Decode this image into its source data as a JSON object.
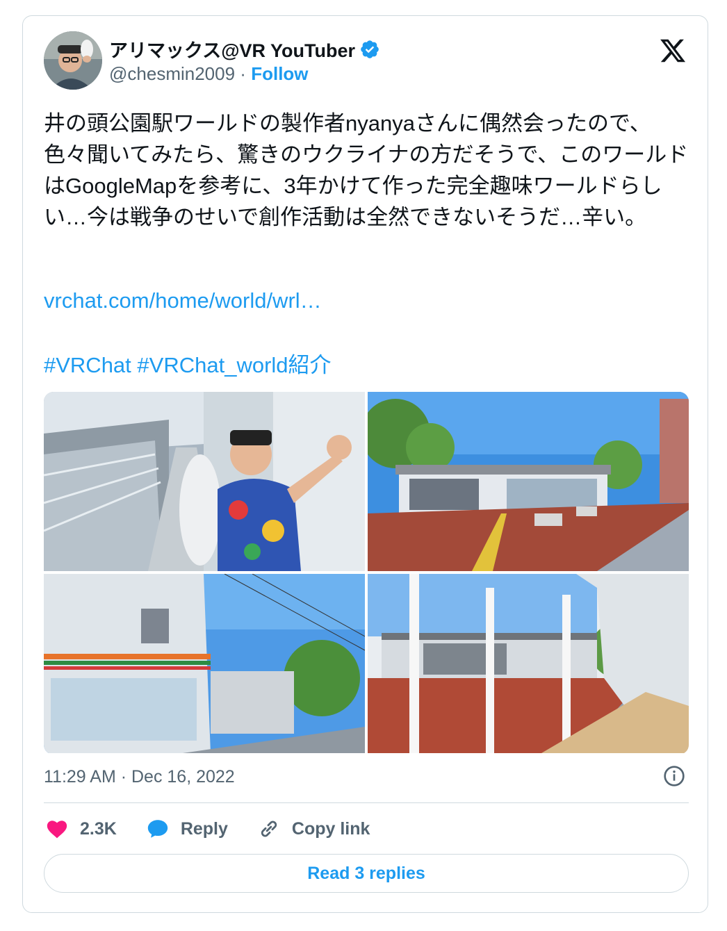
{
  "author": {
    "display_name": "アリマックス@VR YouTuber",
    "handle": "@chesmin2009",
    "separator": "·",
    "follow_label": "Follow",
    "verified": true
  },
  "tweet": {
    "text": "井の頭公園駅ワールドの製作者nyanyaさんに偶然会ったので、色々聞いてみたら、驚きのウクライナの方だそうで、このワールドはGoogleMapを参考に、3年かけて作った完全趣味ワールドらしい…今は戦争のせいで創作活動は全然できないそうだ…辛い。",
    "link": "vrchat.com/home/world/wrl…",
    "hashtags": [
      "#VRChat",
      "#VRChat_world紹介"
    ],
    "timestamp": "11:29 AM · Dec 16, 2022"
  },
  "media": {
    "images": [
      "station-platform-selfie",
      "station-building-exterior",
      "convenience-store-street",
      "station-interior-view"
    ]
  },
  "actions": {
    "like_count": "2.3K",
    "reply_label": "Reply",
    "copy_link_label": "Copy link"
  },
  "footer": {
    "read_replies_label": "Read 3 replies"
  },
  "icons": {
    "verified": "verified-badge-icon",
    "brand": "x-logo-icon",
    "info": "info-icon",
    "like": "heart-icon",
    "reply": "reply-bubble-icon",
    "copy": "link-icon"
  },
  "colors": {
    "accent": "#1d9bf0",
    "like": "#f91880",
    "text": "#0f1419",
    "muted": "#536471",
    "border": "#cfd9de"
  }
}
